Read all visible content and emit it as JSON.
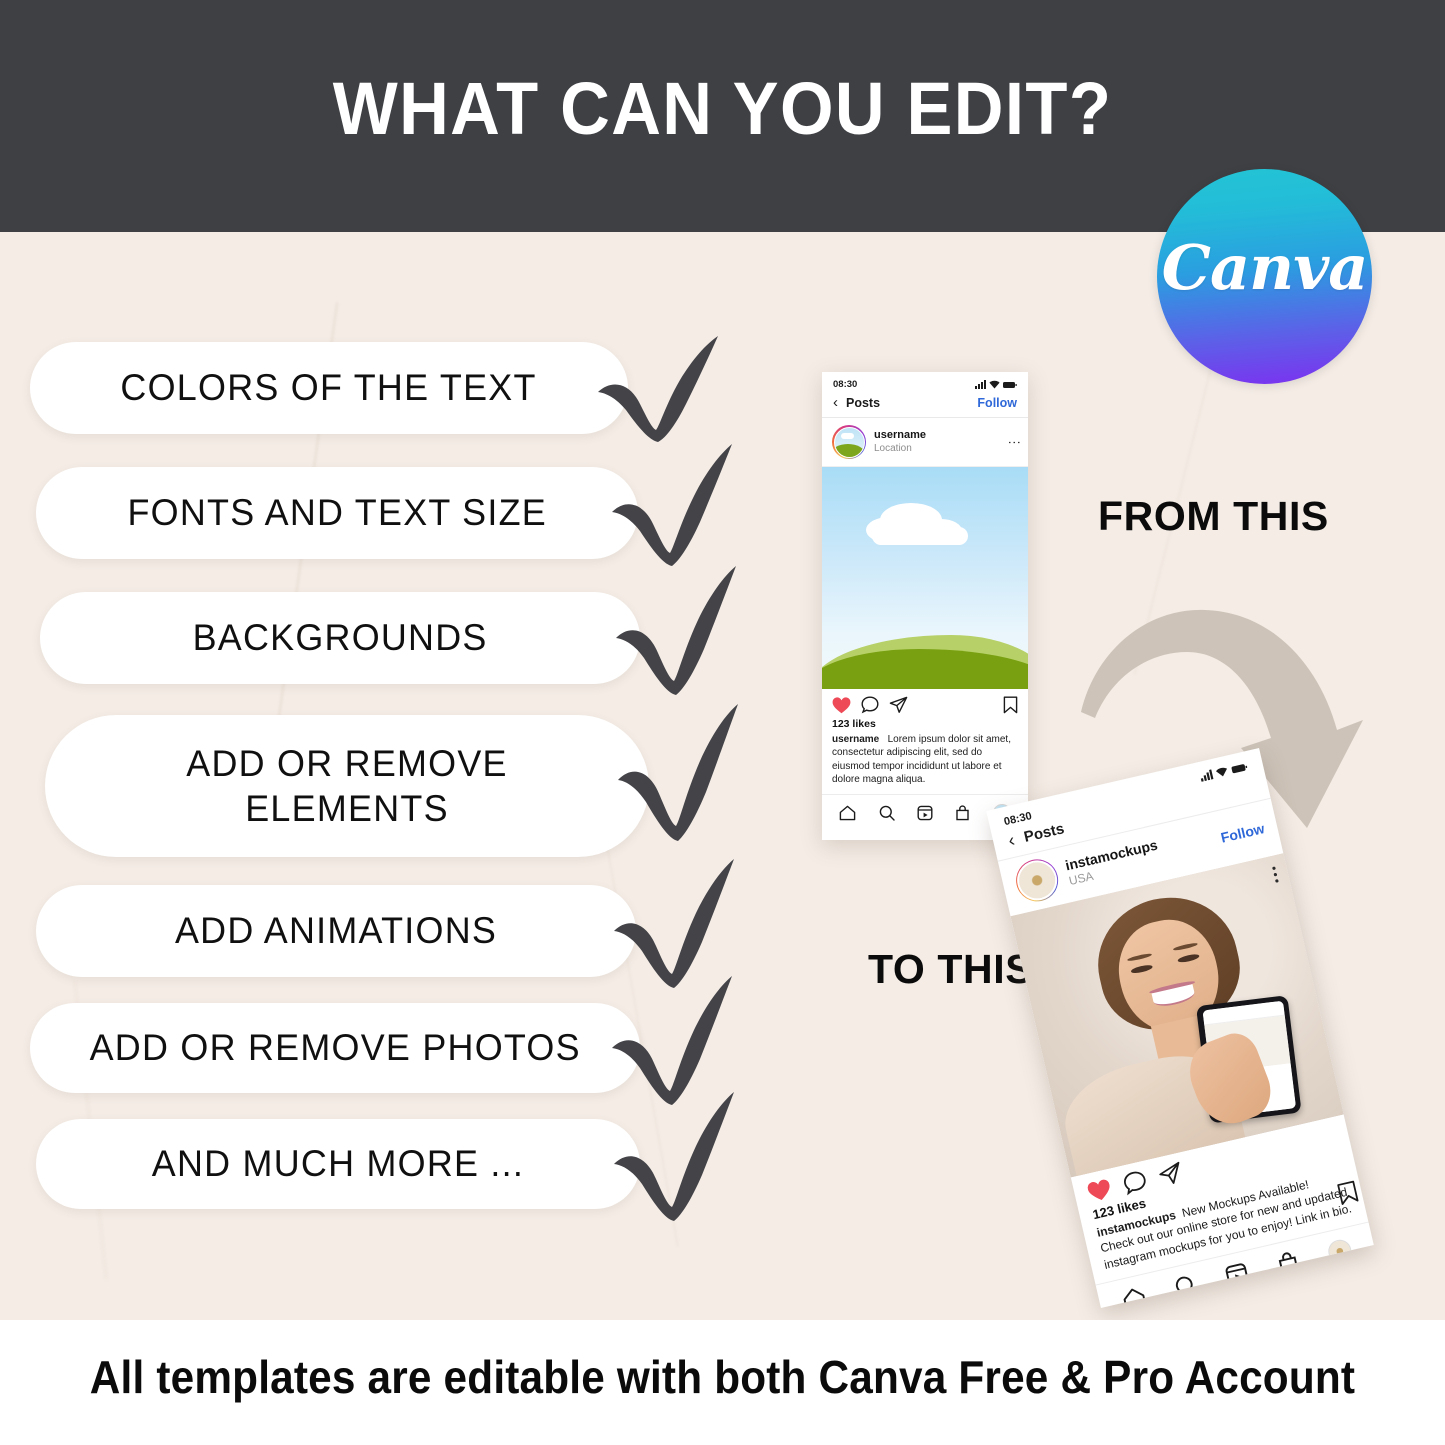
{
  "header": {
    "title": "WHAT CAN YOU EDIT?"
  },
  "brand": {
    "name": "Canva",
    "gradient_top": "#23c4d4",
    "gradient_bottom": "#7d2ff0"
  },
  "colors": {
    "header_bg": "#3e4044",
    "page_bg": "#f2e9e1",
    "pill_bg": "#ffffff",
    "check_color": "#434348",
    "arrow_color": "#cdc3b8",
    "link_blue": "#2f68d8",
    "heart_red": "#ed4956"
  },
  "features": [
    {
      "label": "COLORS OF THE TEXT",
      "check": "check-icon"
    },
    {
      "label": "FONTS AND TEXT SIZE",
      "check": "check-icon"
    },
    {
      "label": "BACKGROUNDS",
      "check": "check-icon"
    },
    {
      "label": "ADD OR REMOVE ELEMENTS",
      "check": "check-icon"
    },
    {
      "label": "ADD ANIMATIONS",
      "check": "check-icon"
    },
    {
      "label": "ADD OR REMOVE PHOTOS",
      "check": "check-icon"
    },
    {
      "label": "AND MUCH MORE ...",
      "check": "check-icon"
    }
  ],
  "labels": {
    "from_this": "FROM THIS",
    "to_this": "TO THIS"
  },
  "phone_from": {
    "status_time": "08:30",
    "nav_back": "‹",
    "nav_title": "Posts",
    "follow": "Follow",
    "username": "username",
    "location": "Location",
    "more": "⋮",
    "likes": "123 likes",
    "caption_user": "username",
    "caption_text": "Lorem ipsum dolor sit amet, consectetur adipiscing elit, sed do eiusmod tempor incididunt ut labore et dolore magna aliqua.",
    "tabs": [
      "home-icon",
      "search-icon",
      "reels-icon",
      "shop-icon",
      "profile-icon"
    ]
  },
  "phone_to": {
    "status_time": "08:30",
    "nav_back": "‹",
    "nav_title": "Posts",
    "follow": "Follow",
    "username": "instamockups",
    "location": "USA",
    "more": "⋮",
    "likes": "123 likes",
    "caption_user": "instamockups",
    "caption_text": "New Mockups Available! Check out our online store for new and updated instagram mockups for you to enjoy! Link in bio.",
    "tabs": [
      "home-icon",
      "search-icon",
      "reels-icon",
      "shop-icon",
      "profile-icon"
    ]
  },
  "footer": {
    "text": "All templates are editable with both Canva Free & Pro Account"
  }
}
